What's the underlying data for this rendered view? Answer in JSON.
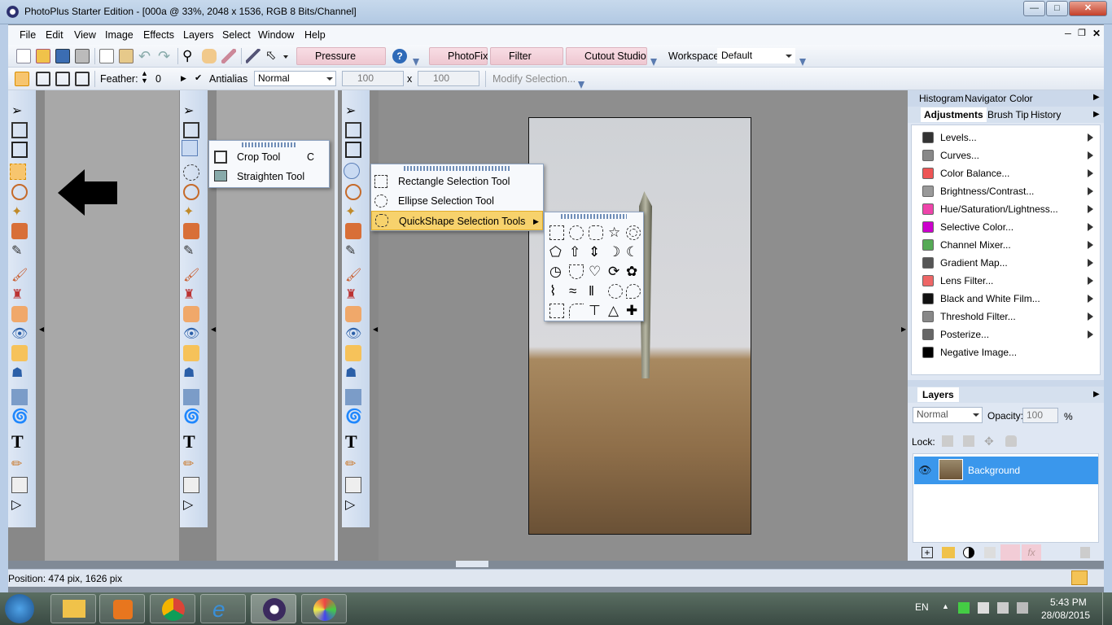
{
  "window": {
    "title": "PhotoPlus Starter Edition - [000a @ 33%, 2048 x 1536, RGB 8 Bits/Channel]"
  },
  "menu": [
    "File",
    "Edit",
    "View",
    "Image",
    "Effects",
    "Layers",
    "Select",
    "Window",
    "Help"
  ],
  "toolbar1": {
    "pressure_studio": "Pressure Studio",
    "photofix": "PhotoFix",
    "filter_gallery": "Filter Gallery",
    "cutout_studio": "Cutout Studio",
    "workspace_label": "Workspace",
    "workspace_value": "Default"
  },
  "toolbar2": {
    "feather_label": "Feather:",
    "feather_value": "0",
    "antialias_label": "Antialias",
    "blend_value": "Normal",
    "width_value": "100",
    "x_label": "x",
    "height_value": "100",
    "modify_selection": "Modify Selection..."
  },
  "crop_flyout": {
    "items": [
      {
        "label": "Crop Tool",
        "shortcut": "C"
      },
      {
        "label": "Straighten Tool"
      }
    ]
  },
  "selection_flyout": {
    "items": [
      "Rectangle Selection Tool",
      "Ellipse Selection Tool",
      "QuickShape Selection Tools"
    ]
  },
  "right_panel": {
    "tabs_row1": [
      "Histogram",
      "Navigator",
      "Color"
    ],
    "tabs_row2": [
      "Adjustments",
      "Brush Tip",
      "History"
    ],
    "adjustments": [
      "Levels...",
      "Curves...",
      "Color Balance...",
      "Brightness/Contrast...",
      "Hue/Saturation/Lightness...",
      "Selective Color...",
      "Channel Mixer...",
      "Gradient Map...",
      "Lens Filter...",
      "Black and White Film...",
      "Threshold Filter...",
      "Posterize...",
      "Negative Image..."
    ],
    "layers_title": "Layers",
    "layer_blend": "Normal",
    "opacity_label": "Opacity:",
    "opacity_value": "100",
    "opacity_unit": "%",
    "lock_label": "Lock:",
    "layer_name": "Background"
  },
  "status": {
    "position": "Position: 474 pix, 1626 pix"
  },
  "taskbar": {
    "lang": "EN",
    "time": "5:43 PM",
    "date": "28/08/2015"
  }
}
